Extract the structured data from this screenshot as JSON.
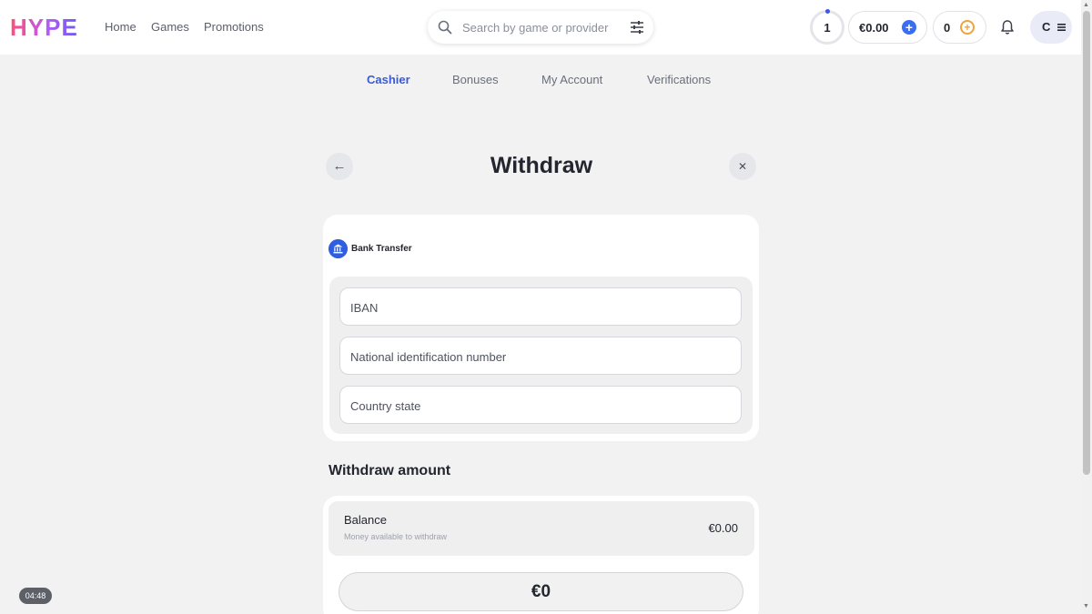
{
  "header": {
    "logo": "HYPE",
    "nav": {
      "home": "Home",
      "games": "Games",
      "promotions": "Promotions"
    },
    "search": {
      "placeholder": "Search by game or provider"
    },
    "level": "1",
    "balance": "€0.00",
    "coins": "0",
    "avatar_initial": "C"
  },
  "tabs": {
    "cashier": "Cashier",
    "bonuses": "Bonuses",
    "account": "My Account",
    "verifications": "Verifications",
    "active": "Cashier"
  },
  "page": {
    "title": "Withdraw",
    "method": "Bank Transfer",
    "fields": {
      "iban": "IBAN",
      "national_id": "National identification number",
      "country_state": "Country state"
    },
    "amount_section": {
      "title": "Withdraw amount",
      "balance_label": "Balance",
      "balance_sub": "Money available to withdraw",
      "balance_value": "€0.00",
      "amount_value": "€0"
    }
  },
  "clock": "04:48",
  "colors": {
    "accent": "#3a5ad6",
    "brand_start": "#ff4f7a",
    "brand_end": "#6b5cf0",
    "coin": "#f0a33a"
  }
}
